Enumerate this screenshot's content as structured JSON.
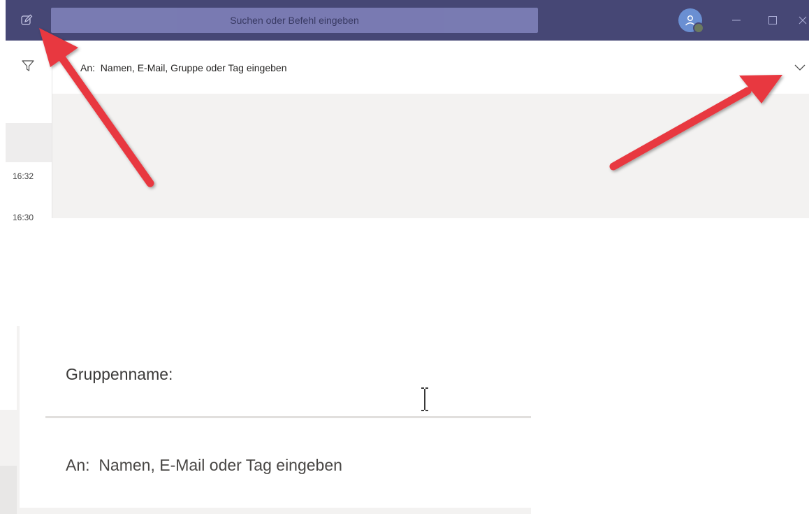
{
  "titlebar": {
    "search_placeholder": "Suchen oder Befehl eingeben",
    "icons": [
      "compose-icon",
      "avatar-icon",
      "minimize-icon",
      "maximize-icon",
      "close-icon"
    ],
    "color": "#464775"
  },
  "leftpane": {
    "icons": [
      "filter-icon"
    ],
    "times": [
      "16:32",
      "16:30"
    ]
  },
  "compose": {
    "to_label": "An:",
    "to_placeholder": "Namen, E-Mail, Gruppe oder Tag eingeben",
    "expand_icon": "chevron-down-icon"
  },
  "inset": {
    "group_name_label": "Gruppenname:",
    "to_label": "An:",
    "to_placeholder": "Namen, E-Mail oder Tag eingeben"
  },
  "annotations": {
    "arrow_color": "#e8373f"
  }
}
